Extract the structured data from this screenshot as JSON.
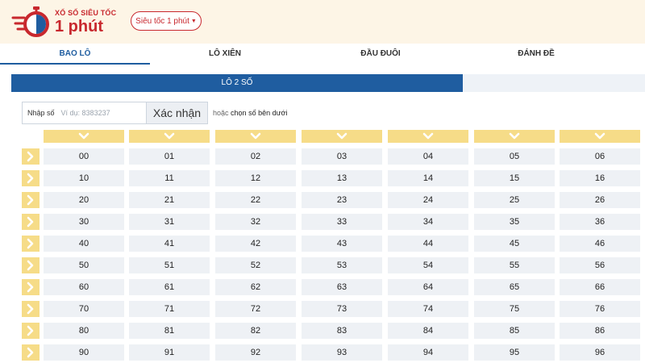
{
  "header": {
    "brand_small": "XỔ SỐ SIÊU TỐC",
    "brand_big": "1 phút",
    "mode_select": "Siêu tốc 1 phút",
    "accent_color": "#c8282e"
  },
  "tabs": [
    {
      "label": "BAO LÔ",
      "active": true
    },
    {
      "label": "LÔ XIÊN",
      "active": false
    },
    {
      "label": "ĐẦU ĐUÔI",
      "active": false
    },
    {
      "label": "ĐÁNH ĐỀ",
      "active": false
    }
  ],
  "subtab": {
    "label": "LÔ 2 SỐ"
  },
  "number_input": {
    "label": "Nhập số",
    "placeholder": "Ví dụ: 8383237",
    "confirm_label": "Xác nhận",
    "hint_prefix": "hoặc",
    "hint_text": "chọn số bên dưới"
  },
  "grid": {
    "column_toggle_icon": "chevron-down-icon",
    "row_toggle_icon": "chevron-right-icon",
    "rows": [
      [
        "00",
        "01",
        "02",
        "03",
        "04",
        "05",
        "06"
      ],
      [
        "10",
        "11",
        "12",
        "13",
        "14",
        "15",
        "16"
      ],
      [
        "20",
        "21",
        "22",
        "23",
        "24",
        "25",
        "26"
      ],
      [
        "30",
        "31",
        "32",
        "33",
        "34",
        "35",
        "36"
      ],
      [
        "40",
        "41",
        "42",
        "43",
        "44",
        "45",
        "46"
      ],
      [
        "50",
        "51",
        "52",
        "53",
        "54",
        "55",
        "56"
      ],
      [
        "60",
        "61",
        "62",
        "63",
        "64",
        "65",
        "66"
      ],
      [
        "70",
        "71",
        "72",
        "73",
        "74",
        "75",
        "76"
      ],
      [
        "80",
        "81",
        "82",
        "83",
        "84",
        "85",
        "86"
      ],
      [
        "90",
        "91",
        "92",
        "93",
        "94",
        "95",
        "96"
      ]
    ]
  }
}
